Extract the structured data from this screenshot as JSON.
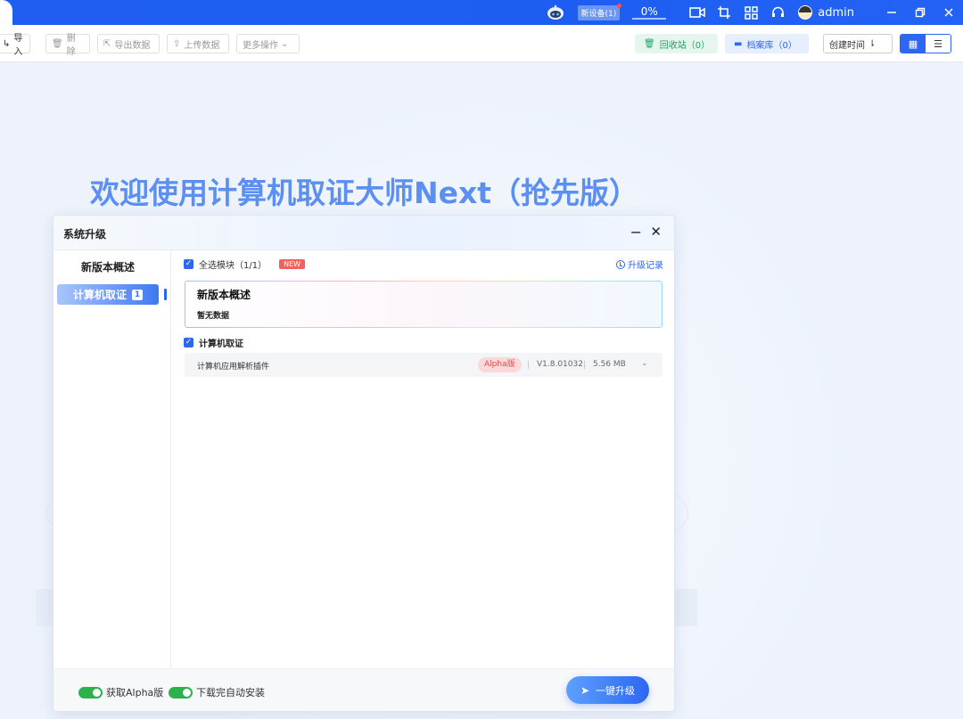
{
  "titlebar": {
    "device_badge": "新设备(1)",
    "percent": "0%",
    "username": "admin",
    "icons": [
      "robot-icon",
      "video-icon",
      "crop-icon",
      "apps-icon",
      "headset-icon",
      "minimize-icon",
      "restore-icon",
      "close-icon"
    ]
  },
  "toolbar": {
    "import": "导入",
    "delete": "删除",
    "export": "导出数据",
    "upload": "上传数据",
    "more": "更多操作",
    "recycle": "回收站（0）",
    "archive": "档案库（0）",
    "sort": "创建时间"
  },
  "welcome": "欢迎使用计算机取证大师Next（抢先版）",
  "dialog": {
    "title": "系统升级",
    "sidebar": [
      {
        "label": "新版本概述"
      },
      {
        "label": "计算机取证",
        "badge": "1"
      }
    ],
    "select_all": "全选模块（1/1）",
    "new_tag": "NEW",
    "history": "升级记录",
    "overview_title": "新版本概述",
    "overview_empty": "暂无数据",
    "module_label": "计算机取证",
    "plugin": {
      "name": "计算机应用解析插件",
      "tag": "Alpha版",
      "version": "V1.8.01032",
      "size": "5.56 MB"
    },
    "footer": {
      "toggle_alpha": "获取Alpha版",
      "toggle_auto": "下载完自动安装",
      "upgrade": "一键升级"
    }
  },
  "colors": {
    "primary": "#2d67f1",
    "success": "#2bb24c",
    "danger": "#e5484d",
    "welcome": "#5b8ff2"
  }
}
